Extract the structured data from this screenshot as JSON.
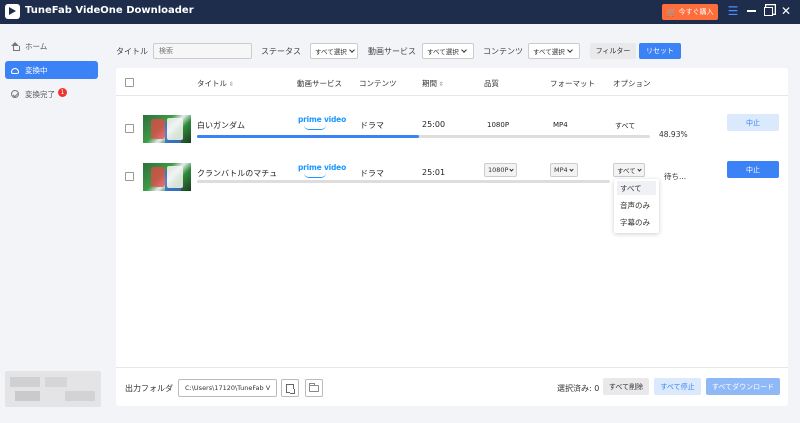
{
  "app": {
    "title": "TuneFab VideOne Downloader"
  },
  "titlebar": {
    "buy_label": "今すぐ購入",
    "cart_glyph": "🛒"
  },
  "sidebar": {
    "items": [
      {
        "label": "ホーム"
      },
      {
        "label": "変換中"
      },
      {
        "label": "変換完了",
        "badge": "1"
      }
    ]
  },
  "filters": {
    "title_label": "タイトル",
    "search_placeholder": "検索",
    "status_label": "ステータス",
    "status_value": "すべて選択",
    "service_label": "動画サービス",
    "service_value": "すべて選択",
    "content_label": "コンテンツ",
    "content_value": "すべて選択",
    "filter_button": "フィルター",
    "reset_button": "リセット"
  },
  "table": {
    "columns": {
      "title": "タイトル",
      "service": "動画サービス",
      "content": "コンテンツ",
      "duration": "期間",
      "quality": "品質",
      "format": "フォーマット",
      "option": "オプション"
    },
    "sort_glyph": "⇳",
    "rows": [
      {
        "title": "白いガンダム",
        "service_text": "prime video",
        "content": "ドラマ",
        "duration": "25:00",
        "quality": "1080P",
        "format": "MP4",
        "option": "すべて",
        "progress_percent": 48.93,
        "progress_label": "48.93%",
        "action": "中止"
      },
      {
        "title": "クランバトルのマチュ",
        "service_text": "prime video",
        "content": "ドラマ",
        "duration": "25:01",
        "quality": "1080P",
        "format": "MP4",
        "option": "すべて",
        "progress_percent": 0,
        "status": "待ち...",
        "action": "中止"
      }
    ]
  },
  "option_dropdown": {
    "items": [
      "すべて",
      "音声のみ",
      "字幕のみ"
    ],
    "selected": 0
  },
  "footer": {
    "output_label": "出力フォルダ",
    "output_path": "C:\\Users\\17120\\TuneFab V",
    "selected_label": "選択済み: 0",
    "delete_all": "すべて削除",
    "stop_all": "すべて停止",
    "download_all": "すべてダウンロード"
  },
  "colors": {
    "titlebar": "#1f2d4d",
    "accent": "#3b82f6",
    "buy": "#ff6d3a",
    "prime": "#1a98ff"
  }
}
